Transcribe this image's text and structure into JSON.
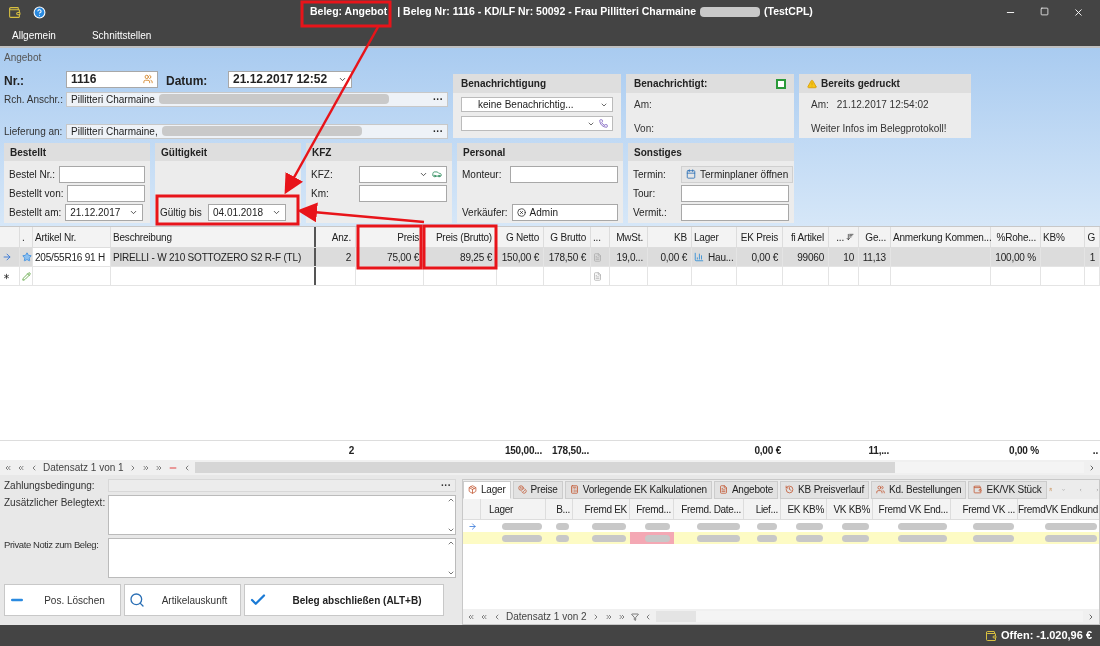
{
  "window": {
    "title": {
      "document_type": "Beleg: Angebot",
      "details": "| Beleg Nr: 1116 -  KD/LF Nr: 50092 - Frau Pillitteri Charmaine",
      "suffix": "(TestCPL)"
    }
  },
  "menu": [
    "Allgemein",
    "Schnittstellen"
  ],
  "form": {
    "group_title": "Angebot",
    "nr_label": "Nr.:",
    "nr": "1116",
    "datum_label": "Datum:",
    "datum": "21.12.2017 12:52",
    "billing_label": "Rch. Anschr.:",
    "billing": "Pillitteri Charmaine",
    "billing_more": "···",
    "delivery_label": "Lieferung an:",
    "delivery": "Pillitteri Charmaine,",
    "delivery_more": "···"
  },
  "notification": {
    "title": "Benachrichtigung",
    "option": "keine Benachrichtig..."
  },
  "notified": {
    "title": "Benachrichtigt:",
    "checked": false,
    "am_label": "Am:",
    "von_label": "Von:"
  },
  "printed": {
    "title": "Bereits gedruckt",
    "am_label": "Am:",
    "am": "21.12.2017 12:54:02",
    "note": "Weiter Infos im Belegprotokoll!"
  },
  "panels": [
    {
      "title": "Bestellt",
      "rows": [
        {
          "label": "Bestel Nr.:",
          "kind": "text"
        },
        {
          "label": "Bestellt von:",
          "kind": "text"
        },
        {
          "label": "Bestellt am:",
          "kind": "dropdown",
          "value": "21.12.2017"
        }
      ]
    },
    {
      "title": "Gültigkeit",
      "rows": [
        {
          "kind": "blank"
        },
        {
          "kind": "blank"
        },
        {
          "label": "Gültig bis",
          "kind": "dropdown",
          "value": "04.01.2018"
        }
      ]
    },
    {
      "title": "KFZ",
      "rows": [
        {
          "label": "KFZ:",
          "kind": "vehicle"
        },
        {
          "label": "Km:",
          "kind": "text"
        },
        {
          "kind": "blank"
        }
      ]
    },
    {
      "title": "Personal",
      "rows": [
        {
          "label": "Monteur:",
          "kind": "text"
        },
        {
          "kind": "blank"
        },
        {
          "label": "Verkäufer:",
          "kind": "user",
          "value": "Admin"
        }
      ]
    },
    {
      "title": "Sonstiges",
      "rows": [
        {
          "label": "Termin:",
          "kind": "button",
          "value": "Terminplaner öffnen"
        },
        {
          "label": "Tour:",
          "kind": "text"
        },
        {
          "label": "Vermit.:",
          "kind": "text"
        }
      ]
    }
  ],
  "table": {
    "columns": [
      {
        "kind": "indicator"
      },
      {
        "label": "."
      },
      {
        "label": "Artikel Nr."
      },
      {
        "label": "Beschreibung"
      },
      {
        "label": "Anz.",
        "total": "2"
      },
      {
        "label": "Preis"
      },
      {
        "label": "Preis (Brutto)"
      },
      {
        "label": "G Netto",
        "total": "150,00..."
      },
      {
        "label": "G Brutto",
        "total": "178,50..."
      },
      {
        "label": "..."
      },
      {
        "label": "MwSt."
      },
      {
        "label": "KB"
      },
      {
        "label": "Lager"
      },
      {
        "label": "EK Preis",
        "total": "0,00 €"
      },
      {
        "label": "fi Artikel"
      },
      {
        "label": "...",
        "kind": "sort"
      },
      {
        "label": "Ge...",
        "total": "11,..."
      },
      {
        "label": "Anmerkung Kommen..."
      },
      {
        "label": "%Rohe...",
        "total": "0,00 %"
      },
      {
        "label": "KB%"
      },
      {
        "label": "G",
        "total": ".."
      }
    ],
    "rows": [
      {
        "selected": true,
        "cells": [
          {
            "kind": "arrow"
          },
          {
            "kind": "star"
          },
          {
            "text": "205/55R16 91 H"
          },
          {
            "text": "PIRELLI - W 210 SOTTOZERO S2 R-F (TL)"
          },
          {
            "text": "2"
          },
          {
            "text": "75,00 €"
          },
          {
            "text": "89,25 €"
          },
          {
            "text": "150,00 €"
          },
          {
            "text": "178,50 €"
          },
          {
            "kind": "doc"
          },
          {
            "text": "19,0..."
          },
          {
            "text": "0,00 €"
          },
          {
            "kind": "chart",
            "text": "Hau..."
          },
          {
            "text": "0,00 €"
          },
          {
            "text": "99060"
          },
          {
            "text": "10"
          },
          {
            "text": "11,13"
          },
          {
            "kind": "blank"
          },
          {
            "text": "100,00 %"
          },
          {
            "kind": "blank"
          },
          {
            "text": "1"
          }
        ]
      },
      {
        "selected": false,
        "cells": [
          {
            "kind": "asterisk"
          },
          {
            "kind": "pencil"
          },
          {
            "kind": "blank"
          },
          {
            "kind": "blank"
          },
          {
            "kind": "blank"
          },
          {
            "kind": "blank"
          },
          {
            "kind": "blank"
          },
          {
            "kind": "blank"
          },
          {
            "kind": "blank"
          },
          {
            "kind": "doc"
          },
          {
            "kind": "blank"
          },
          {
            "kind": "blank"
          },
          {
            "kind": "blank"
          },
          {
            "kind": "blank"
          },
          {
            "kind": "blank"
          },
          {
            "kind": "blank"
          },
          {
            "kind": "blank"
          },
          {
            "kind": "blank"
          },
          {
            "kind": "blank"
          },
          {
            "kind": "blank"
          },
          {
            "kind": "blank"
          }
        ]
      }
    ],
    "navigator": "Datensatz 1 von 1"
  },
  "bottom": {
    "payment_label": "Zahlungsbedingung:",
    "payment_more": "···",
    "text_label": "Zusätzlicher Belegtext:",
    "note_label": "Private Notiz zum Beleg:",
    "buttons": [
      {
        "label": "Pos. Löschen",
        "kind": "delete",
        "primary": false
      },
      {
        "label": "Artikelauskunft",
        "kind": "info",
        "primary": false
      },
      {
        "label": "Beleg abschließen (ALT+B)",
        "kind": "confirm",
        "primary": true
      }
    ]
  },
  "detail": {
    "tabs": [
      {
        "label": "Lager",
        "selected": true,
        "kind": "box"
      },
      {
        "label": "Preise",
        "selected": false,
        "kind": "money"
      },
      {
        "label": "Vorlegende EK Kalkulationen",
        "selected": false,
        "kind": "calc"
      },
      {
        "label": "Angebote",
        "selected": false,
        "kind": "doc"
      },
      {
        "label": "KB Preisverlauf",
        "selected": false,
        "kind": "history"
      },
      {
        "label": "Kd. Bestellungen",
        "selected": false,
        "kind": "people"
      },
      {
        "label": "EK/VK Stück",
        "selected": false,
        "kind": "chart"
      }
    ],
    "columns": [
      "Lager",
      "B...",
      "Fremd EK",
      "Fremd...",
      "Fremd. Date...",
      "Lief...",
      "EK KB%",
      "VK KB%",
      "Fremd VK End...",
      "Fremd VK ...",
      "FremdVK Endkund"
    ],
    "rows": [
      {
        "current": true,
        "highlighted": false
      },
      {
        "current": false,
        "highlighted": true
      }
    ],
    "navigator": "Datensatz 1 von 2"
  },
  "status_bar": {
    "open_amount": "Offen: -1.020,96 €"
  },
  "annotations": [
    {
      "kind": "frame"
    },
    {
      "kind": "frame"
    },
    {
      "kind": "frame"
    },
    {
      "kind": "frame"
    },
    {
      "kind": "arrow"
    },
    {
      "kind": "arrow"
    }
  ]
}
